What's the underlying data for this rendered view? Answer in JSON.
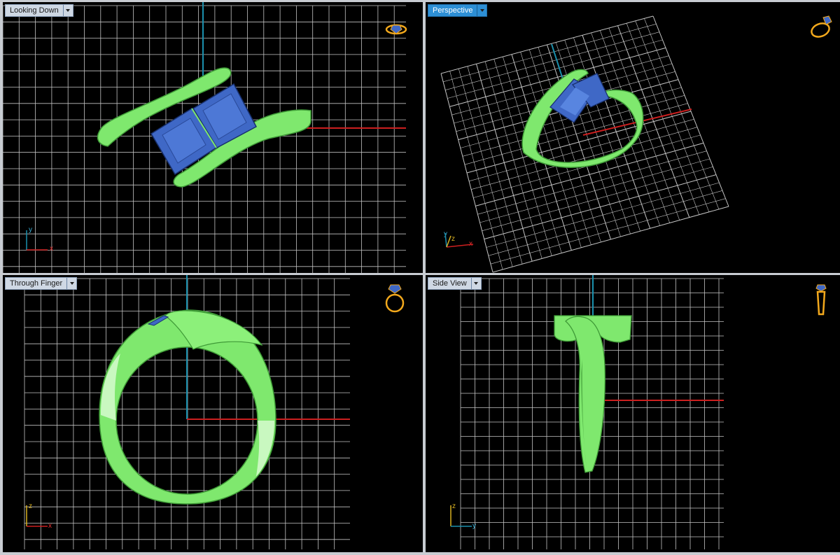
{
  "colors": {
    "grid": "#c4c4c4",
    "axis_x": "#cc1f1f",
    "axis_y": "#1b90ad",
    "ring": "#7fe86e",
    "ring_shadow": "#3f9a37",
    "stone": "#3f68c6",
    "icon": "#f2a81c",
    "background": "#000000"
  },
  "viewports": {
    "top_left": {
      "label": "Looking Down",
      "active": false,
      "view_icon": "ring-top-view-icon",
      "axis_labels": {
        "horizontal": "x",
        "vertical": "y"
      }
    },
    "top_right": {
      "label": "Perspective",
      "active": true,
      "view_icon": "ring-perspective-icon",
      "axis_labels": {
        "horizontal": "x",
        "vertical": "y",
        "depth": "z"
      }
    },
    "bottom_left": {
      "label": "Through Finger",
      "active": false,
      "view_icon": "ring-front-view-icon",
      "axis_labels": {
        "horizontal": "x",
        "vertical": "z"
      }
    },
    "bottom_right": {
      "label": "Side View",
      "active": false,
      "view_icon": "ring-side-view-icon",
      "axis_labels": {
        "horizontal": "y",
        "vertical": "z"
      }
    }
  }
}
